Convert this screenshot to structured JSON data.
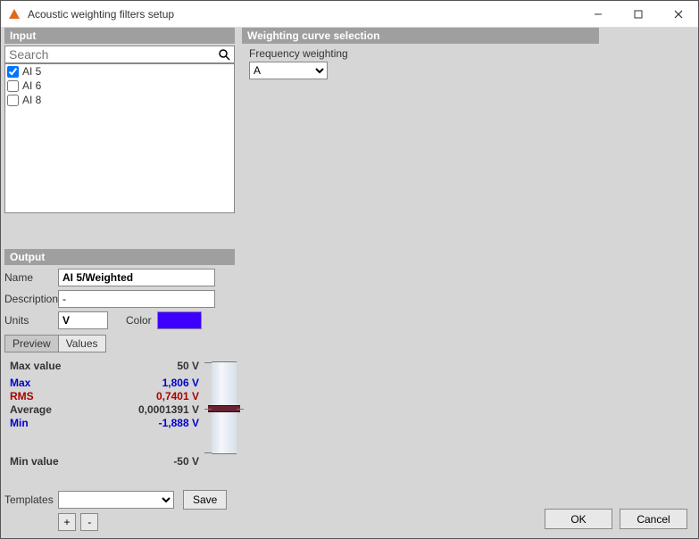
{
  "window": {
    "title": "Acoustic weighting filters setup"
  },
  "input": {
    "header": "Input",
    "search_placeholder": "Search",
    "channels": [
      {
        "label": "AI 5",
        "checked": true
      },
      {
        "label": "AI 6",
        "checked": false
      },
      {
        "label": "AI 8",
        "checked": false
      }
    ]
  },
  "weighting": {
    "header": "Weighting curve selection",
    "label": "Frequency weighting",
    "selected": "A"
  },
  "output": {
    "header": "Output",
    "name_label": "Name",
    "name_value": "AI 5/Weighted",
    "description_label": "Description",
    "description_value": "-",
    "units_label": "Units",
    "units_value": "V",
    "color_label": "Color",
    "color_value": "#3d00ff",
    "tabs": {
      "preview": "Preview",
      "values": "Values"
    },
    "preview": {
      "max_value_label": "Max value",
      "max_value": "50 V",
      "max_label": "Max",
      "max": "1,806 V",
      "rms_label": "RMS",
      "rms": "0,7401 V",
      "avg_label": "Average",
      "avg": "0,0001391 V",
      "min_label": "Min",
      "min": "-1,888 V",
      "min_value_label": "Min value",
      "min_value": "-50 V"
    },
    "templates_label": "Templates",
    "save_label": "Save",
    "plus": "+",
    "minus": "-"
  },
  "buttons": {
    "ok": "OK",
    "cancel": "Cancel"
  }
}
